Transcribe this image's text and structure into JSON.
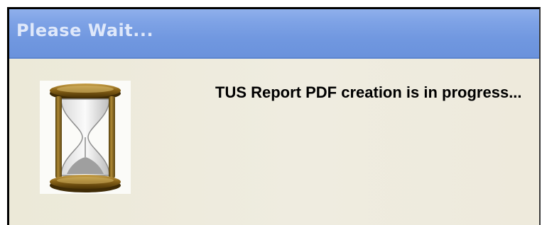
{
  "window": {
    "title": "Please Wait..."
  },
  "content": {
    "icon": "hourglass-icon",
    "message": "TUS Report PDF creation is in progress..."
  },
  "colors": {
    "titlebar": "#7198e0",
    "title_text": "#dfe8fa",
    "dialog_background": "#ece9d8",
    "message_text": "#000000"
  }
}
